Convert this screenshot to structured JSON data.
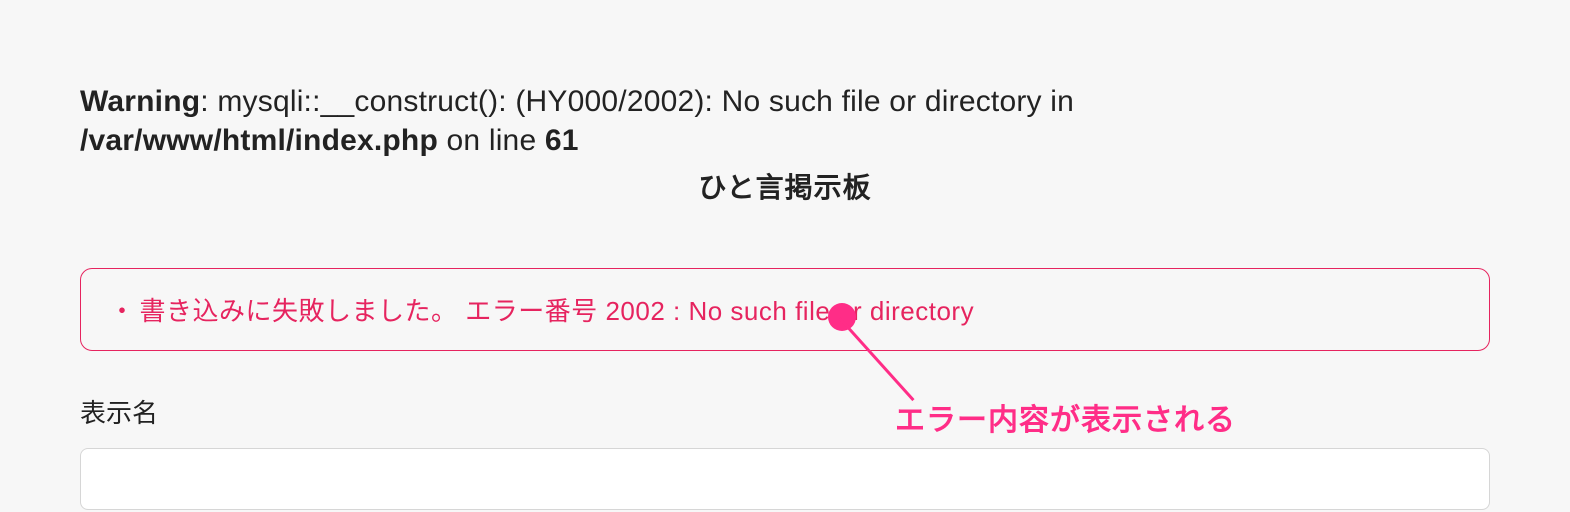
{
  "warning": {
    "label": "Warning",
    "message_1": ": mysqli::__construct(): (HY000/2002): No such file or directory in ",
    "path": "/var/www/html/index.php",
    "on_line": " on line ",
    "line_number": "61"
  },
  "heading": "ひと言掲示板",
  "error": {
    "bullet": "・",
    "message": "書き込みに失敗しました。 エラー番号 2002 : No such file or directory"
  },
  "form": {
    "display_name_label": "表示名",
    "display_name_value": ""
  },
  "annotation": {
    "text": "エラー内容が表示される"
  }
}
